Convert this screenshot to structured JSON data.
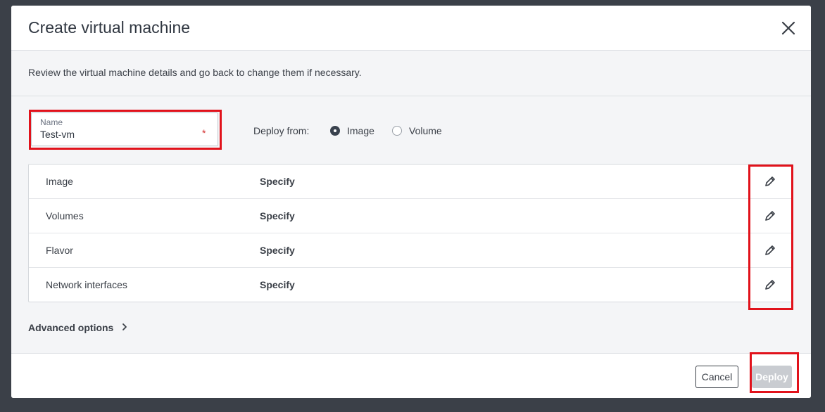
{
  "dialog": {
    "title": "Create virtual machine",
    "intro": "Review the virtual machine details and go back to change them if necessary."
  },
  "name_field": {
    "label": "Name",
    "value": "Test-vm",
    "required_marker": "*"
  },
  "deploy_from": {
    "label": "Deploy from:",
    "options": [
      {
        "label": "Image",
        "selected": true
      },
      {
        "label": "Volume",
        "selected": false
      }
    ]
  },
  "details": [
    {
      "label": "Image",
      "value": "Specify"
    },
    {
      "label": "Volumes",
      "value": "Specify"
    },
    {
      "label": "Flavor",
      "value": "Specify"
    },
    {
      "label": "Network interfaces",
      "value": "Specify"
    }
  ],
  "advanced_options": {
    "label": "Advanced options"
  },
  "footer": {
    "cancel_label": "Cancel",
    "deploy_label": "Deploy",
    "deploy_enabled": false
  },
  "icons": {
    "close": "close-icon",
    "edit": "pencil-icon",
    "chevron": "chevron-right-icon"
  },
  "colors": {
    "highlight": "#e1121b",
    "deploy_disabled_bg": "#c9ccd1",
    "text": "#3a3f47"
  }
}
